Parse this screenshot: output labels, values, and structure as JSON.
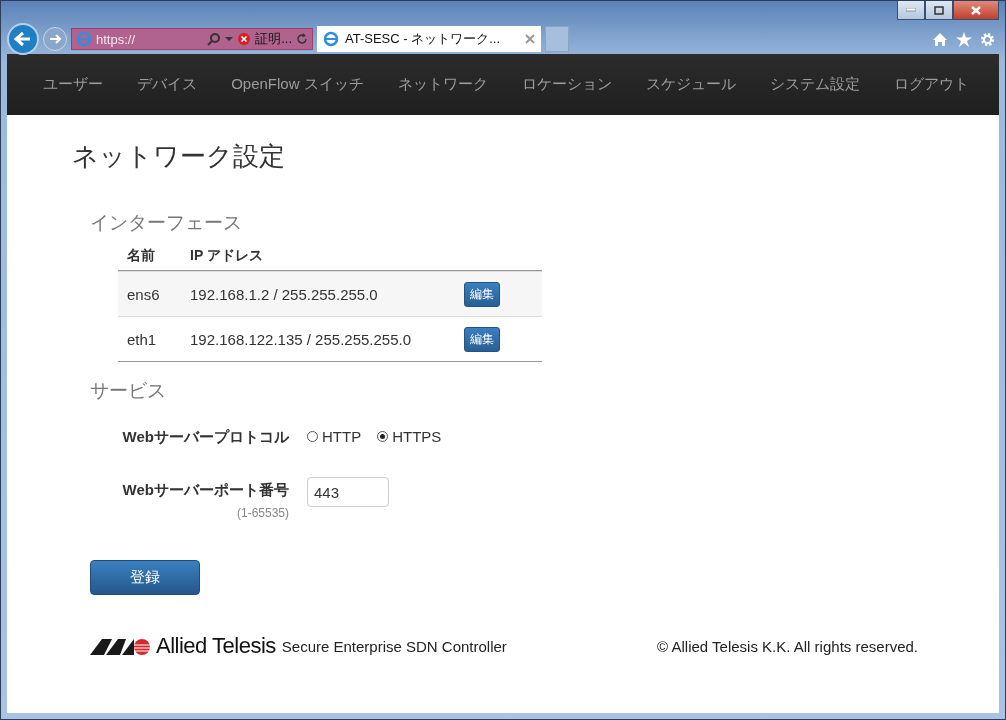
{
  "browser": {
    "address": "https://",
    "cert_warning": "証明...",
    "tab_title": "AT-SESC - ネットワーク...",
    "tab_selected": true
  },
  "nav": {
    "items": [
      {
        "label": "ユーザー",
        "selected": false
      },
      {
        "label": "デバイス",
        "selected": false
      },
      {
        "label": "OpenFlow スイッチ",
        "selected": false
      },
      {
        "label": "ネットワーク",
        "selected": false
      },
      {
        "label": "ロケーション",
        "selected": false
      },
      {
        "label": "スケジュール",
        "selected": false
      },
      {
        "label": "システム設定",
        "selected": false
      },
      {
        "label": "ログアウト",
        "selected": false
      }
    ]
  },
  "page_title": "ネットワーク設定",
  "interfaces": {
    "heading": "インターフェース",
    "columns": [
      "名前",
      "IP アドレス"
    ],
    "rows": [
      {
        "name": "ens6",
        "address": "192.168.1.2 / 255.255.255.0",
        "action": "編集"
      },
      {
        "name": "eth1",
        "address": "192.168.122.135 / 255.255.255.0",
        "action": "編集"
      }
    ]
  },
  "services": {
    "heading": "サービス",
    "protocol": {
      "label": "Webサーバープロトコル",
      "options": [
        {
          "label": "HTTP",
          "selected": false
        },
        {
          "label": "HTTPS",
          "selected": true
        }
      ]
    },
    "port": {
      "label": "Webサーバーポート番号",
      "hint": "(1-65535)",
      "value": "443"
    }
  },
  "submit": "登録",
  "footer": {
    "brand": "Allied Telesis",
    "product": "Secure Enterprise SDN Controller",
    "copyright": "© Allied Telesis K.K. All rights reserved."
  }
}
